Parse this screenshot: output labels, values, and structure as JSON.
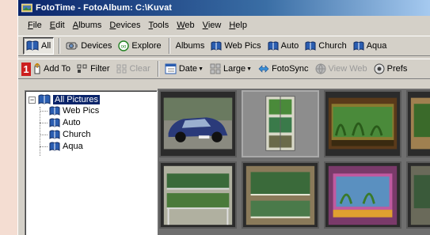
{
  "window": {
    "title": "FotoTime - FotoAlbum:  C:\\Kuvat"
  },
  "menu": [
    {
      "u": "F",
      "rest": "ile"
    },
    {
      "u": "E",
      "rest": "dit"
    },
    {
      "u": "A",
      "rest": "lbums"
    },
    {
      "u": "D",
      "rest": "evices"
    },
    {
      "u": "T",
      "rest": "ools"
    },
    {
      "u": "W",
      "rest": "eb"
    },
    {
      "u": "V",
      "rest": "iew"
    },
    {
      "u": "H",
      "rest": "elp"
    }
  ],
  "toolbar1": {
    "all": "All",
    "devices": "Devices",
    "explore": "Explore",
    "albums": "Albums",
    "web_pics": "Web Pics",
    "auto": "Auto",
    "church": "Church",
    "aqua": "Aqua"
  },
  "toolbar2": {
    "badge": "1",
    "add_to": "Add To",
    "filter": "Filter",
    "clear": "Clear",
    "date": "Date",
    "large": "Large",
    "fotosync": "FotoSync",
    "view_web": "View Web",
    "prefs": "Prefs"
  },
  "tree": {
    "root": "All Pictures",
    "children": [
      "Web Pics",
      "Auto",
      "Church",
      "Aqua"
    ]
  },
  "colors": {
    "accent_blue": "#0a246a",
    "badge_red": "#cc1f1f",
    "background": "#f4ddd2"
  }
}
